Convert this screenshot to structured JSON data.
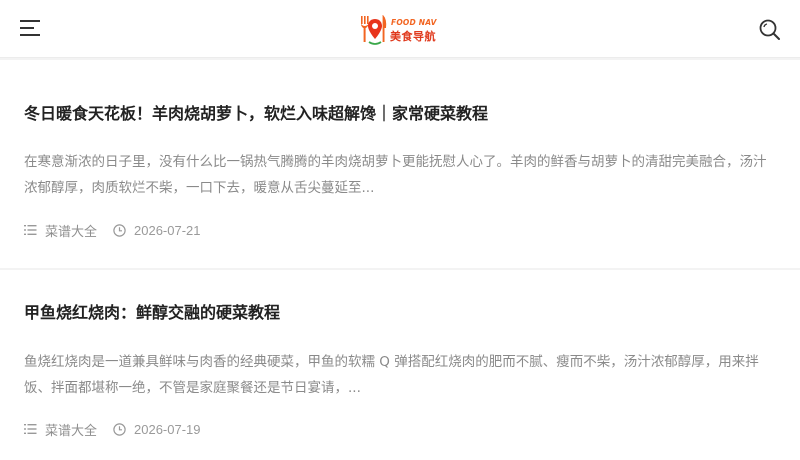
{
  "header": {
    "logo_top": "FOOD NAV",
    "logo_bottom": "美食导航",
    "menu_icon": "hamburger-menu-icon",
    "search_icon": "search-icon",
    "brand_color": "#f26522",
    "brand_color_dark": "#e03a1e"
  },
  "articles": [
    {
      "title": "冬日暖食天花板！羊肉烧胡萝卜，软烂入味超解馋｜家常硬菜教程",
      "excerpt": "在寒意渐浓的日子里，没有什么比一锅热气腾腾的羊肉烧胡萝卜更能抚慰人心了。羊肉的鲜香与胡萝卜的清甜完美融合，汤汁浓郁醇厚，肉质软烂不柴，一口下去，暖意从舌尖蔓延至...",
      "category": "菜谱大全",
      "date": "2026-07-21"
    },
    {
      "title": "甲鱼烧红烧肉：鲜醇交融的硬菜教程",
      "excerpt": "鱼烧红烧肉是一道兼具鲜味与肉香的经典硬菜，甲鱼的软糯 Q 弹搭配红烧肉的肥而不腻、瘦而不柴，汤汁浓郁醇厚，用来拌饭、拌面都堪称一绝，不管是家庭聚餐还是节日宴请，...",
      "category": "菜谱大全",
      "date": "2026-07-19"
    }
  ]
}
